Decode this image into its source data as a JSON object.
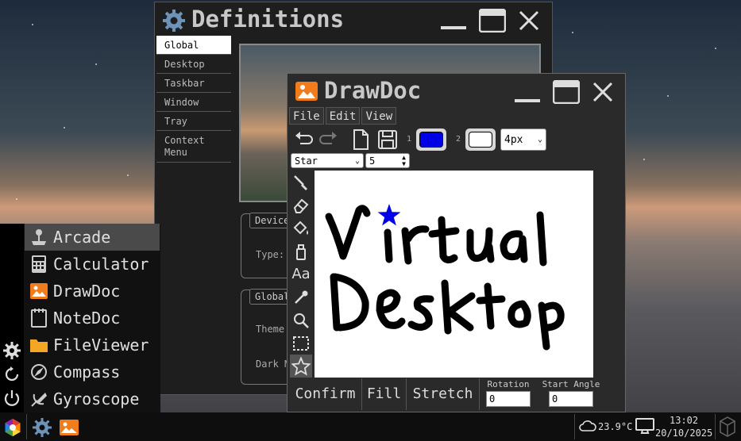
{
  "definitions_window": {
    "title": "Definitions",
    "nav": [
      "Global",
      "Desktop",
      "Taskbar",
      "Window",
      "Tray",
      "Context Menu"
    ],
    "groups": [
      {
        "legend": "Device",
        "label": "Type:"
      },
      {
        "legend": "Global",
        "labels": [
          "Theme",
          "Dark M"
        ]
      }
    ]
  },
  "start_menu": {
    "items": [
      "Arcade",
      "Calculator",
      "DrawDoc",
      "NoteDoc",
      "FileViewer",
      "Compass",
      "Gyroscope"
    ],
    "active_index": 0
  },
  "drawdoc_window": {
    "title": "DrawDoc",
    "menu": [
      "File",
      "Edit",
      "View"
    ],
    "toolbar": {
      "swatch1_label": "1",
      "swatch2_label": "2",
      "color1": "#0000e6",
      "color2": "#ffffff",
      "stroke_width": "4px"
    },
    "shape_select": "Star",
    "points_value": "5",
    "tools": [
      "brush-icon",
      "eraser-icon",
      "fill-bucket-icon",
      "spray-icon",
      "text-icon",
      "eyedropper-icon",
      "zoom-icon",
      "select-icon",
      "star-tool-icon"
    ],
    "active_tool": "star-tool-icon",
    "canvas_text": [
      "Virtual",
      "Desktop"
    ],
    "bottom": {
      "confirm": "Confirm",
      "fill": "Fill",
      "stretch": "Stretch",
      "rotation_label": "Rotation",
      "rotation_value": "0",
      "start_angle_label": "Start Angle",
      "start_angle_value": "0"
    }
  },
  "taskbar": {
    "temperature": "23.9°C",
    "time": "13:02",
    "date": "20/10/2025"
  },
  "colors": {
    "accent_orange": "#f07c1c",
    "taskbar_bg": "#0e0e0e",
    "window_bg": "#1e1e1e"
  }
}
